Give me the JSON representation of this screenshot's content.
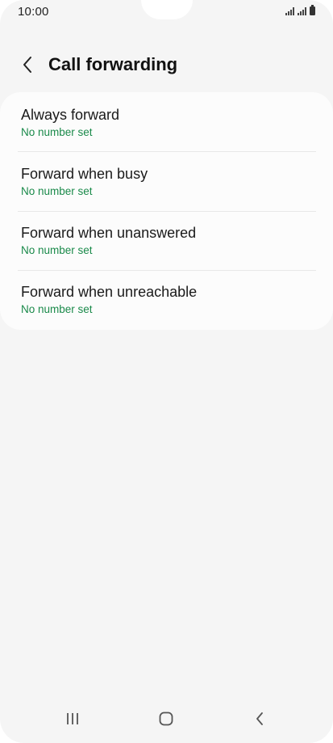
{
  "status_bar": {
    "time": "10:00",
    "icons": [
      "signal-sim1-icon",
      "signal-sim2-icon",
      "battery-icon"
    ]
  },
  "header": {
    "back_icon": "chevron-left-icon",
    "title": "Call forwarding"
  },
  "options": [
    {
      "title": "Always forward",
      "subtitle": "No number set"
    },
    {
      "title": "Forward when busy",
      "subtitle": "No number set"
    },
    {
      "title": "Forward when unanswered",
      "subtitle": "No number set"
    },
    {
      "title": "Forward when unreachable",
      "subtitle": "No number set"
    }
  ],
  "navigation_bar": {
    "buttons": [
      "recent-apps-icon",
      "home-icon",
      "back-icon"
    ]
  },
  "colors": {
    "background": "#f5f5f5",
    "card": "#fcfcfc",
    "subtitle_green": "#1a8a4a",
    "text": "#1a1a1a"
  }
}
